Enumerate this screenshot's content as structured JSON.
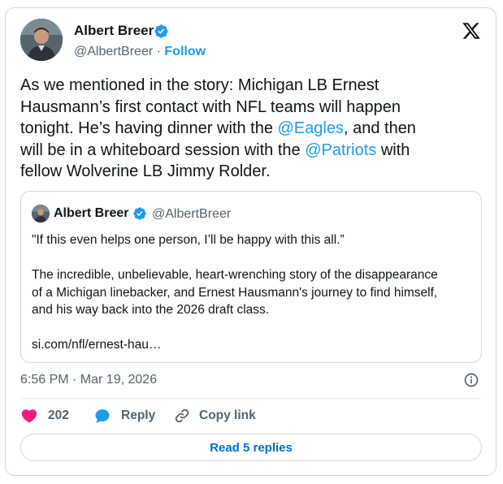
{
  "colors": {
    "accent": "#1d9bf0",
    "like": "#f91880",
    "muted": "#536471",
    "text": "#0f1419"
  },
  "author": {
    "name": "Albert Breer",
    "handle": "@AlbertBreer",
    "separator": " · ",
    "follow_label": "Follow",
    "verified_icon": "verified-badge-icon"
  },
  "platform_icon": "x-logo-icon",
  "tweet": {
    "text_1": "As we mentioned in the story: Michigan LB Ernest\nHausmann’s first contact with NFL teams will happen\ntonight. He’s having dinner with the ",
    "mention_1": "@Eagles",
    "text_2": ", and then\nwill be in a whiteboard session with the ",
    "mention_2": "@Patriots",
    "text_3": " with\nfellow Wolverine LB Jimmy Rolder."
  },
  "quote": {
    "name": "Albert Breer",
    "handle": "@AlbertBreer",
    "text": "\"If this even helps one person, I’ll be happy with this all.”\n\nThe incredible, unbelievable, heart-wrenching story of the disappearance\nof a Michigan linebacker, and Ernest Hausmann's journey to find himself,\nand his way back into the 2026 draft class.\n\nsi.com/nfl/ernest-hau…"
  },
  "timestamp": "6:56 PM · Mar 19, 2026",
  "actions": {
    "like_count": "202",
    "reply_label": "Reply",
    "copy_link_label": "Copy link"
  },
  "read_replies_label": "Read 5 replies"
}
